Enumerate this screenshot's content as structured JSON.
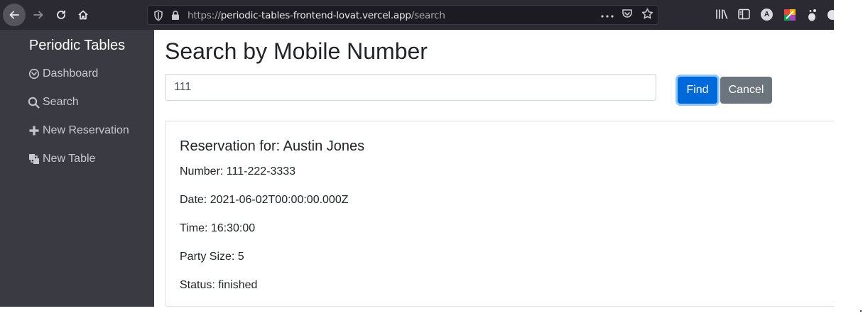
{
  "browser": {
    "url_scheme": "https://",
    "url_host": "periodic-tables-frontend-lovat.vercel.app",
    "url_path": "/search",
    "account_initial": "A"
  },
  "sidebar": {
    "brand": "Periodic Tables",
    "items": [
      {
        "label": "Dashboard",
        "icon": "dashboard-icon"
      },
      {
        "label": "Search",
        "icon": "search-icon"
      },
      {
        "label": "New Reservation",
        "icon": "plus-icon"
      },
      {
        "label": "New Table",
        "icon": "layers-icon"
      }
    ]
  },
  "main": {
    "title": "Search by Mobile Number",
    "search_value": "111",
    "find_label": "Find",
    "cancel_label": "Cancel"
  },
  "reservation": {
    "title": "Reservation for: Austin Jones",
    "number": "Number: 111-222-3333",
    "date": "Date: 2021-06-02T00:00:00.000Z",
    "time": "Time: 16:30:00",
    "party_size": "Party Size: 5",
    "status": "Status: finished"
  },
  "colors": {
    "sidebar_bg": "#3a3a43",
    "primary": "#0069d9",
    "secondary": "#6c757d",
    "chrome_bg": "#2b2a33"
  }
}
